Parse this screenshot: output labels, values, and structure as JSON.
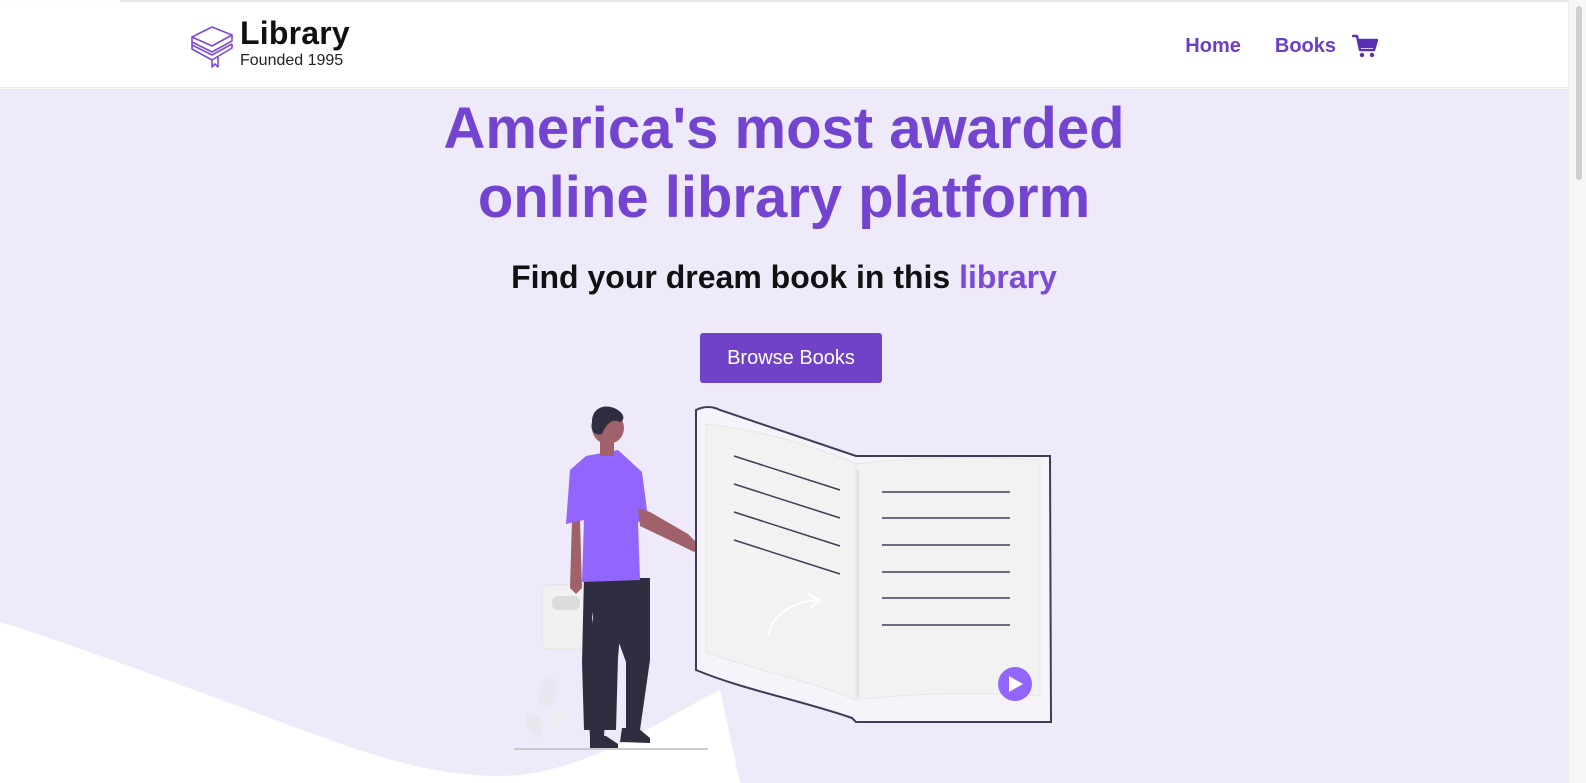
{
  "header": {
    "logo_title": "Library",
    "logo_subtitle": "Founded 1995",
    "logo_icon": "books-stack-icon",
    "nav": [
      {
        "label": "Home"
      },
      {
        "label": "Books"
      }
    ],
    "cart_icon": "shopping-cart-icon"
  },
  "hero": {
    "headline_line1": "America's most awarded",
    "headline_line2": "online library platform",
    "subheading_prefix": "Find your dream book in this ",
    "subheading_accent": "library",
    "cta_label": "Browse Books",
    "illustration": "person-reading-open-book-illustration"
  },
  "colors": {
    "brand_purple": "#7344cf",
    "button_purple": "#6f42c8",
    "hero_background": "#efeaf9",
    "nav_text": "#6b3fc4"
  }
}
